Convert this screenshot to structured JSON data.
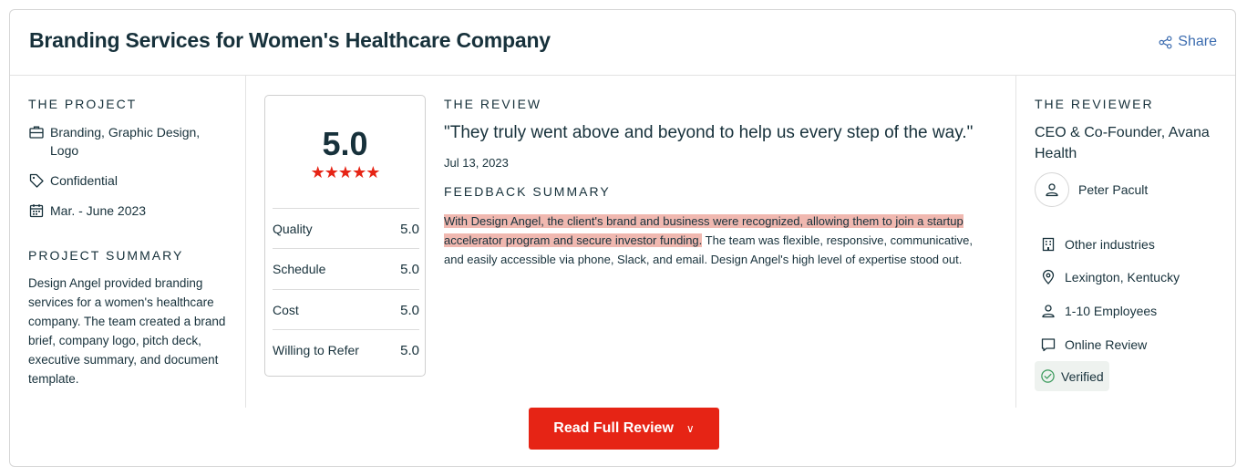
{
  "header": {
    "title": "Branding Services for Women's Healthcare Company",
    "share_label": "Share"
  },
  "project": {
    "section_label": "THE PROJECT",
    "services": "Branding, Graphic Design, Logo",
    "budget": "Confidential",
    "dates": "Mar. - June 2023",
    "summary_label": "PROJECT SUMMARY",
    "summary": "Design Angel provided branding services for a women's healthcare company. The team created a brand brief, company logo, pitch deck, executive summary, and document template."
  },
  "ratings": {
    "overall": "5.0",
    "stars": "★★★★★",
    "rows": [
      {
        "label": "Quality",
        "value": "5.0"
      },
      {
        "label": "Schedule",
        "value": "5.0"
      },
      {
        "label": "Cost",
        "value": "5.0"
      },
      {
        "label": "Willing to Refer",
        "value": "5.0"
      }
    ]
  },
  "review": {
    "section_label": "THE REVIEW",
    "quote": "\"They truly went above and beyond to help us every step of the way.\"",
    "date": "Jul 13, 2023",
    "feedback_label": "FEEDBACK SUMMARY",
    "feedback_highlight": "With Design Angel, the client's brand and business were recognized, allowing them to join a startup accelerator program and secure investor funding.",
    "feedback_rest": " The team was flexible, responsive, communicative, and easily accessible via phone, Slack, and email. Design Angel's high level of expertise stood out."
  },
  "reviewer": {
    "section_label": "THE REVIEWER",
    "title": "CEO & Co-Founder, Avana Health",
    "name": "Peter Pacult",
    "industry": "Other industries",
    "location": "Lexington, Kentucky",
    "employees": "1-10 Employees",
    "review_type": "Online Review",
    "verified": "Verified"
  },
  "actions": {
    "read_full_review": "Read Full Review"
  },
  "colors": {
    "accent": "#e62415",
    "link": "#3d6db0",
    "highlight": "#f0b8b0",
    "text": "#17313b"
  }
}
